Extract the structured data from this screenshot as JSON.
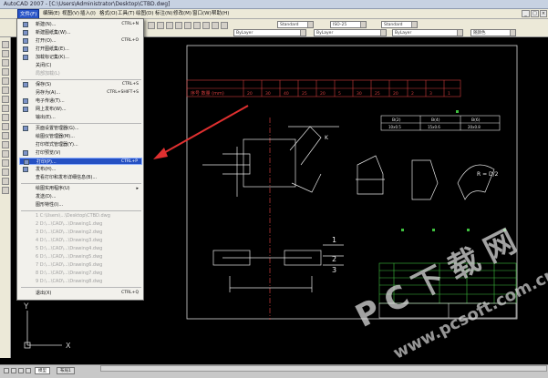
{
  "window": {
    "title": "AutoCAD 2007 - [C:\\Users\\Administrator\\Desktop\\CTBD.dwg]"
  },
  "menu": {
    "items": [
      "文件(F)",
      "编辑(E)",
      "视图(V)",
      "插入(I)",
      "格式(O)",
      "工具(T)",
      "绘图(D)",
      "标注(N)",
      "修改(M)",
      "窗口(W)",
      "帮助(H)"
    ],
    "active_index": 0
  },
  "toolbar": {
    "style1": "Standard",
    "style2": "ISO-25",
    "style3": "Standard",
    "layer": "ByLayer",
    "linetype": "ByLayer",
    "lineweight": "ByLayer",
    "plotstyle": "随颜色"
  },
  "file_menu": {
    "items": [
      {
        "label": "新建(N)...",
        "shortcut": "CTRL+N",
        "disabled": false
      },
      {
        "label": "新建图纸集(W)...",
        "shortcut": "",
        "disabled": false
      },
      {
        "label": "打开(O)...",
        "shortcut": "CTRL+O",
        "disabled": false
      },
      {
        "label": "打开图纸集(E)...",
        "shortcut": "",
        "disabled": false
      },
      {
        "label": "加载标记集(K)...",
        "shortcut": "",
        "disabled": false
      },
      {
        "label": "关闭(C)",
        "shortcut": "",
        "disabled": false
      },
      {
        "label": "局部加载(L)",
        "shortcut": "",
        "disabled": true
      },
      {
        "label": "保存(S)",
        "shortcut": "CTRL+S",
        "disabled": false
      },
      {
        "label": "另存为(A)...",
        "shortcut": "CTRL+SHIFT+S",
        "disabled": false
      },
      {
        "label": "电子传递(T)...",
        "shortcut": "",
        "disabled": false
      },
      {
        "label": "网上发布(W)...",
        "shortcut": "",
        "disabled": false
      },
      {
        "label": "输出(E)...",
        "shortcut": "",
        "disabled": false
      },
      {
        "label": "页面设置管理器(G)...",
        "shortcut": "",
        "disabled": false
      },
      {
        "label": "绘图仪管理器(M)...",
        "shortcut": "",
        "disabled": false
      },
      {
        "label": "打印样式管理器(Y)...",
        "shortcut": "",
        "disabled": false
      },
      {
        "label": "打印预览(V)",
        "shortcut": "",
        "disabled": false
      },
      {
        "label": "打印(P)...",
        "shortcut": "CTRL+P",
        "disabled": false
      },
      {
        "label": "发布(H)...",
        "shortcut": "",
        "disabled": false
      },
      {
        "label": "查看打印和发布详细信息(B)...",
        "shortcut": "",
        "disabled": false
      },
      {
        "label": "绘图实用程序(U)",
        "shortcut": "",
        "disabled": false
      },
      {
        "label": "发送(D)...",
        "shortcut": "",
        "disabled": false
      },
      {
        "label": "图形特性(I)...",
        "shortcut": "",
        "disabled": false
      },
      {
        "label": "1 C:\\Users\\...\\Desktop\\CTBD.dwg",
        "shortcut": "",
        "disabled": true
      },
      {
        "label": "2 D:\\...\\CAD\\...\\Drawing1.dwg",
        "shortcut": "",
        "disabled": true
      },
      {
        "label": "3 D:\\...\\CAD\\...\\Drawing2.dwg",
        "shortcut": "",
        "disabled": true
      },
      {
        "label": "4 D:\\...\\CAD\\...\\Drawing3.dwg",
        "shortcut": "",
        "disabled": true
      },
      {
        "label": "5 D:\\...\\CAD\\...\\Drawing4.dwg",
        "shortcut": "",
        "disabled": true
      },
      {
        "label": "6 D:\\...\\CAD\\...\\Drawing5.dwg",
        "shortcut": "",
        "disabled": true
      },
      {
        "label": "7 D:\\...\\CAD\\...\\Drawing6.dwg",
        "shortcut": "",
        "disabled": true
      },
      {
        "label": "8 D:\\...\\CAD\\...\\Drawing7.dwg",
        "shortcut": "",
        "disabled": true
      },
      {
        "label": "9 D:\\...\\CAD\\...\\Drawing8.dwg",
        "shortcut": "",
        "disabled": true
      },
      {
        "label": "退出(X)",
        "shortcut": "CTRL+Q",
        "disabled": false
      }
    ],
    "highlight_index": 16
  },
  "drawing": {
    "table_row_label": "序号 数量 (mm)",
    "table_values": [
      "20",
      "30",
      "40",
      "25",
      "20",
      "5",
      "30",
      "25",
      "20",
      "2",
      "3",
      "1"
    ],
    "callouts": [
      "1",
      "2",
      "3"
    ],
    "note": "R = D/2",
    "spec_headers": [
      "B(2)",
      "B(4)",
      "B(6)"
    ],
    "spec_values": [
      "10x0.5",
      "15x0.6",
      "20x0.8"
    ]
  },
  "layout_tabs": [
    "模型",
    "布局1"
  ],
  "watermark": {
    "brand": "PC下载网",
    "url": "www.pcsoft.com.cn"
  },
  "colors": {
    "menu_highlight": "#2550c2",
    "arrow": "#e03030",
    "table_red": "#d23c3c",
    "canvas": "#000000"
  }
}
